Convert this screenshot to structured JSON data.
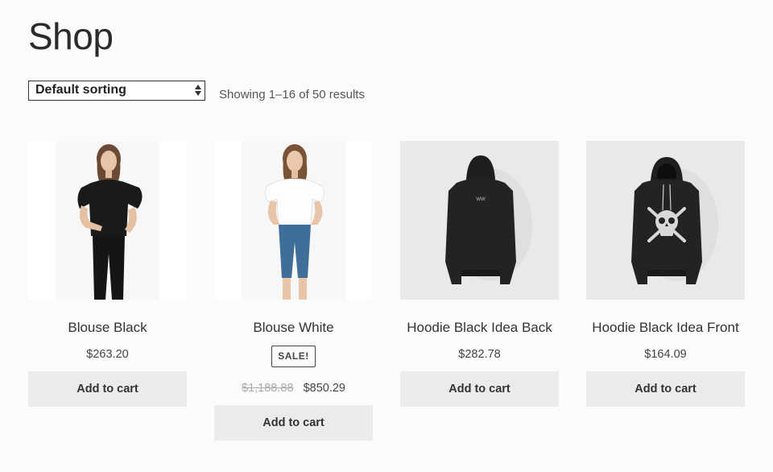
{
  "page": {
    "title": "Shop"
  },
  "toolbar": {
    "sort_selected": "Default sorting",
    "result_count": "Showing 1–16 of 50 results"
  },
  "products": [
    {
      "title": "Blouse Black",
      "price": "$263.20",
      "button": "Add to cart",
      "image": "woman-black-blouse"
    },
    {
      "title": "Blouse White",
      "badge": "SALE!",
      "regular_price": "$1,188.88",
      "sale_price": "$850.29",
      "button": "Add to cart",
      "image": "woman-white-blouse"
    },
    {
      "title": "Hoodie Black Idea Back",
      "price": "$282.78",
      "button": "Add to cart",
      "image": "black-hoodie-back"
    },
    {
      "title": "Hoodie Black Idea Front",
      "price": "$164.09",
      "button": "Add to cart",
      "image": "black-hoodie-front-skull"
    }
  ],
  "colors": {
    "background": "#fbfbfb",
    "button_bg": "#ebebeb",
    "hoodie_bg": "#e9e9e9"
  }
}
